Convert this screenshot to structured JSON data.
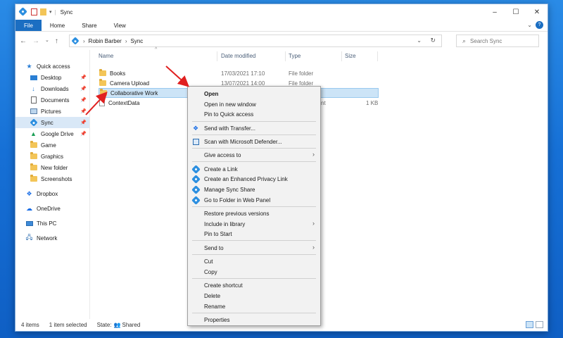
{
  "window": {
    "title": "Sync"
  },
  "ribbon": {
    "tabs": [
      "File",
      "Home",
      "Share",
      "View"
    ],
    "help": "?"
  },
  "address": {
    "crumbs": [
      "Robin Barber",
      "Sync"
    ],
    "search_placeholder": "Search Sync"
  },
  "sidebar": {
    "quick_access": "Quick access",
    "items": [
      {
        "label": "Desktop",
        "icon": "desktop-icon"
      },
      {
        "label": "Downloads",
        "icon": "download-icon"
      },
      {
        "label": "Documents",
        "icon": "document-icon"
      },
      {
        "label": "Pictures",
        "icon": "picture-icon"
      },
      {
        "label": "Sync",
        "icon": "sync-icon"
      },
      {
        "label": "Google Drive",
        "icon": "google-drive-icon"
      },
      {
        "label": "Game",
        "icon": "folder-icon"
      },
      {
        "label": "Graphics",
        "icon": "folder-icon"
      },
      {
        "label": "New folder",
        "icon": "folder-icon"
      },
      {
        "label": "Screenshots",
        "icon": "folder-icon"
      }
    ],
    "dropbox": "Dropbox",
    "onedrive": "OneDrive",
    "this_pc": "This PC",
    "network": "Network"
  },
  "columns": {
    "name": "Name",
    "date": "Date modified",
    "type": "Type",
    "size": "Size"
  },
  "files": [
    {
      "name": "Books",
      "date": "17/03/2021 17:10",
      "type": "File folder",
      "size": ""
    },
    {
      "name": "Camera Upload",
      "date": "13/07/2021 14:00",
      "type": "File folder",
      "size": ""
    },
    {
      "name": "Collaborative Work",
      "date": "",
      "type": "",
      "size": ""
    },
    {
      "name": "ContextData",
      "date": "",
      "type": "nt",
      "size": "1 KB"
    }
  ],
  "status": {
    "items": "4 items",
    "selected": "1 item selected",
    "state_label": "State:",
    "state_value": "Shared"
  },
  "context_menu": {
    "open": "Open",
    "open_new_window": "Open in new window",
    "pin_quick_access": "Pin to Quick access",
    "send_transfer": "Send with Transfer...",
    "scan_defender": "Scan with Microsoft Defender...",
    "give_access": "Give access to",
    "create_link": "Create a Link",
    "create_privacy_link": "Create an Enhanced Privacy Link",
    "manage_sync_share": "Manage Sync Share",
    "go_web_panel": "Go to Folder in Web Panel",
    "restore_versions": "Restore previous versions",
    "include_library": "Include in library",
    "pin_start": "Pin to Start",
    "send_to": "Send to",
    "cut": "Cut",
    "copy": "Copy",
    "create_shortcut": "Create shortcut",
    "delete": "Delete",
    "rename": "Rename",
    "properties": "Properties"
  },
  "colors": {
    "accent": "#1b6ec2",
    "selection": "#cce4f7",
    "arrow": "#e02020",
    "sync": "#2c8fe0"
  }
}
